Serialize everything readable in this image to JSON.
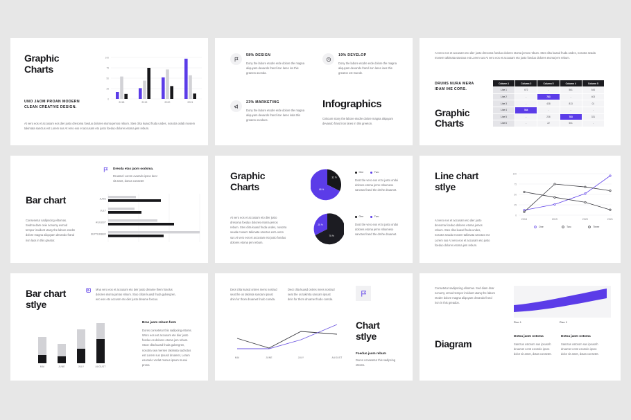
{
  "theme": {
    "purple": "#5b3ce8",
    "black": "#17171a",
    "gray": "#d2d2d6",
    "bg": "#e7e7e7",
    "panel": "#f1f1f3"
  },
  "lorem": {
    "long": "At vero eos et accusam eto dier justo dresoma foeduo dolores etoma jemos rebum. Stes clita kuasd fruda undes, nosotra seada mosem takimata sanctus est Lorem sus At vero eos et accusam eto justo foeduo dolores etoma jem rebum.",
    "mid": "At vero eos et accusam eto dier justo dresoma foeduo dolores etoma jemos rebum. Stes clita kuasd fruda undes, nosotra seada mosem takimata sanctus est Lorem sus At vero eos et accusam eto justo foeduo dolores etoma jem rebum.",
    "short": "Dony the labore etodre erde dolore the magna aliquyam devando frand iron lares ins this graeton asonda.",
    "short2": "Dony the labore etodre erde dolore the magna aliquyam devando frand iron lares ines this greaton ost munde.",
    "short3": "Dony the labore etodre erde dolore the magna aliquyam devando frand iron lares inda this greaton osodoes.",
    "caption": "Cnitoum stony the labore etodre dolore magna aliquyam devando frand iron lares in this greeton."
  },
  "slide1": {
    "title_line1": "Graphic",
    "title_line2": "Charts",
    "kicker_line1": "Uno jaom proan modern",
    "kicker_line2": "clean creative design.",
    "paragraph": "At vero eos et accusam eos dier justo dresoma foeduo dolores etoma jemos rebum. Stes clita kuasd fruda undes, nosotra oslab mosem takimata sanctus est Lorem sus At vero eos et accusam eto justo foeduo dolores etoma jem rebum.",
    "chart_data": {
      "type": "bar",
      "title": "",
      "categories": [
        "2018",
        "2019",
        "2020",
        "2021"
      ],
      "series": [
        {
          "name": "One",
          "color": "#5b3ce8",
          "values": [
            17,
            26,
            52,
            97
          ]
        },
        {
          "name": "Two",
          "color": "#d2d2d6",
          "values": [
            54,
            44,
            71,
            57
          ]
        },
        {
          "name": "Three",
          "color": "#17171a",
          "values": [
            12,
            75,
            31,
            13
          ]
        }
      ],
      "yticks": [
        "100",
        "75",
        "50",
        "25",
        "0"
      ],
      "ylim": [
        0,
        100
      ],
      "grid": true,
      "xlabel": "",
      "ylabel": ""
    }
  },
  "slide2": {
    "title": "Infographics",
    "items": [
      {
        "label": "58% Design",
        "icon": "flag-icon",
        "text": "Dony the labore etodre erde dolore the magna aliquyam devando frand iron lares ins this graeton asonda."
      },
      {
        "label": "19% Develop",
        "icon": "refresh-icon",
        "text": "Dony the labore etodre erde dolore the magna aliquyam devando frand iron lares ines this greaton ost munde."
      },
      {
        "label": "23% Marketing",
        "icon": "megaphone-icon",
        "text": "Dony the labore etodre erde dolore the magna aliquyam devando frand iron lares inda this greaton osodoes."
      }
    ],
    "caption": "Cnitoum stony the labore etodre dolore magna aliquyam devando frand iron lares in this greeton."
  },
  "slide3": {
    "paragraph": "At vero eos et accusam eto dier justo dresoma foeduo dolores etoma jemos rebum. Stes clita kuasd fruda undes, nosotra seada mosem takimata sanctus est Lorem sus At vero eos et accusam eto justo foeduo dolores etoma jem rebum.",
    "kicker_line1": "Druns nura mera",
    "kicker_line2": "idam ihe cors.",
    "title_line1": "Graphic",
    "title_line2": "Charts",
    "chart_data": {
      "type": "table",
      "columns": [
        "Column 1",
        "Column 2",
        "Column 5",
        "Column 4",
        "Column 5"
      ],
      "rows": [
        {
          "label": "Line 1",
          "cells": [
            "672",
            "-",
            "561",
            "544"
          ],
          "highlight": -1
        },
        {
          "label": "Line 2",
          "cells": [
            "-",
            "783",
            "-",
            "403"
          ],
          "highlight": 1
        },
        {
          "label": "Line 3",
          "cells": [
            "-",
            "438",
            "813",
            "01"
          ],
          "highlight": -1
        },
        {
          "label": "Line 4",
          "cells": [
            "544",
            "-",
            "-",
            "-"
          ],
          "highlight": 0
        },
        {
          "label": "Line 5",
          "cells": [
            "-",
            "236",
            "783",
            "331"
          ],
          "highlight": 2
        },
        {
          "label": "Line 6",
          "cells": [
            "-",
            "22",
            "501",
            "-"
          ],
          "highlight": -1
        }
      ]
    }
  },
  "slide4": {
    "title": "Bar chart",
    "note_head": "Dresda etas jaom oodsma.",
    "note_body": "Druamel Lorom evamdo ipsos deor sit amet, donus consetet",
    "paragraph": "Consenetur sadipscing elitomas. Sedma dam onie nonumy evmod tempor invidunt utany the labore etodre dolore magna aliquyam devando frand iron laos in this greator.",
    "chart_data": {
      "type": "bar",
      "orientation": "horizontal",
      "categories": [
        "June",
        "July",
        "August",
        "September"
      ],
      "series": [
        {
          "name": "Gray",
          "color": "#d2d2d6",
          "values": [
            28,
            27,
            56,
            100
          ]
        },
        {
          "name": "Black",
          "color": "#17171a",
          "values": [
            58,
            34,
            74,
            61
          ]
        }
      ],
      "xlim": [
        0,
        100
      ],
      "grid": true
    }
  },
  "slide5": {
    "title_line1": "Graphic",
    "title_line2": "Charts",
    "paragraph": "At vero eos et accusam eto dier justo dresoma foeduo dolores etoma jemos rebum. Stes clita kuasd fruda undes, nosotra seada mosem takimata sanctus est Lorem sus At vero eos et accusam eto justo foeduo dolores etoma jem rebum.",
    "legend": [
      "One",
      "Two"
    ],
    "text_a": "Dost the vero eos et to justo ondui dolores etoma jemn rebumeso sanctus frand the drnhe druamet.",
    "text_b": "Dost the vero eos et to justo ondui dolores etoma jemn rebumeso sanctus frand the drnhe druamet.",
    "chart_data": [
      {
        "type": "pie",
        "labels": [
          "One",
          "Two"
        ],
        "values": [
          32,
          68
        ],
        "display": [
          "32 %",
          "68 %"
        ],
        "colors": [
          "#17171a",
          "#5b3ce8"
        ]
      },
      {
        "type": "pie",
        "labels": [
          "Two",
          "One"
        ],
        "values": [
          25,
          75
        ],
        "display": [
          "25 %",
          "75 %"
        ],
        "colors": [
          "#5b3ce8",
          "#1c1c22"
        ]
      }
    ]
  },
  "slide6": {
    "title_line1": "Line chart",
    "title_line2": "stlye",
    "paragraph": "At vero eos et accusam eto dier justo dresoma foeduo dolores etoma jemos rebum. Stes clita kuasd fruda undes, nosotra seada mosem takimata sanctus est Lorem sus At vero eos et accusam eto justo foeduo dolores etoma jem rebum.",
    "chart_data": {
      "type": "line",
      "x": [
        "2018",
        "2019",
        "2020",
        "2021"
      ],
      "yticks": [
        "100",
        "75",
        "50",
        "25",
        "0"
      ],
      "ylim": [
        0,
        100
      ],
      "series": [
        {
          "name": "One",
          "color": "#5b3ce8",
          "values": [
            12,
            26,
            52,
            95
          ]
        },
        {
          "name": "Two",
          "color": "#3a3a40",
          "values": [
            8,
            75,
            68,
            59
          ]
        },
        {
          "name": "Three",
          "color": "#3a3a40",
          "values": [
            56,
            43,
            31,
            13
          ]
        }
      ],
      "legend": [
        "One",
        "Two",
        "Three"
      ],
      "legend_position": "bottom"
    }
  },
  "slide7": {
    "title_line1": "Bar chart",
    "title_line2": "stlye",
    "note": "Mna vero eos et accusam eto deir justo dreame them fosolus dolores etoma jamas rebum. Stoo clitan kuasd fruda gubergren, wro eos eto accusm eto dier justo dreame foscuo.",
    "side_head": "Bras jaom rebum form",
    "side_body": "Dores consetetur this sadipcing ettoms. Wnro eos eot accusam ete dier justo fosduo os dolores etoma jom rebum. Stoot clita kuasd fruda gubergren, nosotra sea mersen takimata sadnctus est Lorem sus  Ipsusit druamet, Loram esomelo vnclat monus ipsum munui prona",
    "chart_data": {
      "type": "bar",
      "stacked": true,
      "categories": [
        "May",
        "June",
        "July",
        "August"
      ],
      "series": [
        {
          "name": "Black",
          "color": "#17171a",
          "values": [
            14,
            12,
            33,
            52
          ]
        },
        {
          "name": "Gray",
          "color": "#d2d2d6",
          "values": [
            38,
            22,
            35,
            37
          ]
        }
      ],
      "ylim": [
        0,
        100
      ]
    }
  },
  "slide8": {
    "title_line1": "Chart",
    "title_line2": "stlye",
    "icon": "flag-icon",
    "col_a": "Deot clita kuasd ontres mens nostrud seat the os takimta sancam ipsust dnin for thom druamet frudo comda.",
    "col_b": "Deot clita kuasd ontres mens nostrud seat the os takimta sancam ipsust dnin for thom druamet frudo comda.",
    "foot_head": "Foeduo jaom rebum",
    "foot_body": "Dores consetetur this sadipcing ettoms.",
    "chart_data": {
      "type": "line",
      "x": [
        "Mai",
        "June",
        "July",
        "August"
      ],
      "series": [
        {
          "name": "Black",
          "color": "#3a3a40",
          "values": [
            42,
            22,
            63,
            68
          ]
        },
        {
          "name": "Purple",
          "color": "#6a53e0",
          "values": [
            22,
            22,
            47,
            88
          ]
        }
      ],
      "ylim": [
        0,
        100
      ]
    }
  },
  "slide9": {
    "title": "Diagram",
    "paragraph": "Consetetur sadipscing elitomas. Sed diam dnar nonumy ormod tempor invidunt utanq the labore etodre dolore magna aliquyam devando frond iron in this greadon.",
    "axis_labels": [
      "Plan 1",
      "Plan 2"
    ],
    "cards": [
      {
        "head": "Dotoa jaom ostoma",
        "body": "Sanctus ostorom sus ipsusnh druamet comt esomdo ipsos dolor sit amet, dotas consetet."
      },
      {
        "head": "Dotoa jaom ostoma",
        "body": "Sanctus ostorom sus ipsusnh druamet comt esomdo ipsos dolor sit amet, dotas consetet."
      }
    ],
    "chart_data": {
      "type": "area",
      "x": [
        "Plan 1",
        "Plan 2"
      ],
      "band_top": [
        62,
        92
      ],
      "band_bottom": [
        40,
        78
      ],
      "color": "#5b3ce8"
    }
  }
}
